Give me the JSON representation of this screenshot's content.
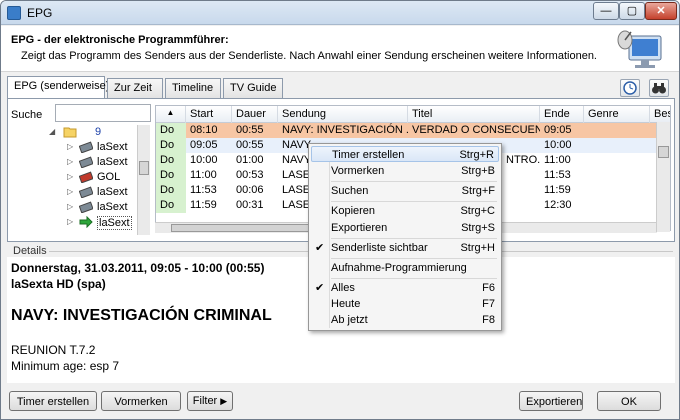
{
  "window": {
    "title": "EPG",
    "close_glyph": "✕",
    "minimize_glyph": "—",
    "maximize_glyph": "▢"
  },
  "header": {
    "title": "EPG - der elektronische Programmführer:",
    "description": "Zeigt das Programm des Senders aus der Senderliste. Nach Anwahl einer Sendung erscheinen weitere Informationen.",
    "icon": "monitor-satellite-icon"
  },
  "tabs": [
    "EPG (senderweise)",
    "Zur Zeit",
    "Timeline",
    "TV Guide"
  ],
  "toolbar": {
    "clock_icon": "clock-icon",
    "search_icon": "binoculars-icon"
  },
  "search": {
    "label": "Suche",
    "value": ""
  },
  "tree": [
    {
      "label": "9",
      "icon": "folder-icon",
      "expanded": true
    },
    {
      "label": "laSext",
      "icon": "channel-icon"
    },
    {
      "label": "laSext",
      "icon": "channel-icon"
    },
    {
      "label": "GOL",
      "icon": "channel-icon"
    },
    {
      "label": "laSext",
      "icon": "channel-icon"
    },
    {
      "label": "laSext",
      "icon": "channel-icon"
    },
    {
      "label": "laSext",
      "icon": "arrow-right-icon",
      "current": true
    }
  ],
  "grid": {
    "columns": [
      "Start",
      "Dauer",
      "Sendung",
      "Titel",
      "Ende",
      "Genre",
      "Bes"
    ],
    "rows": [
      {
        "day": "Do",
        "start": "08:10",
        "dauer": "00:55",
        "sendung": "NAVY: INVESTIGACIÓN ...",
        "titel": "VERDAD O CONSECUEN...",
        "ende": "09:05",
        "selected": true
      },
      {
        "day": "Do",
        "start": "09:05",
        "dauer": "00:55",
        "sendung": "NAVY",
        "titel": "",
        "ende": "10:00"
      },
      {
        "day": "Do",
        "start": "10:00",
        "dauer": "01:00",
        "sendung": "NAVY",
        "titel": "NTRO...",
        "ende": "11:00"
      },
      {
        "day": "Do",
        "start": "11:00",
        "dauer": "00:53",
        "sendung": "LASE",
        "titel": "",
        "ende": "11:53"
      },
      {
        "day": "Do",
        "start": "11:53",
        "dauer": "00:06",
        "sendung": "LASE",
        "titel": "",
        "ende": "11:59"
      },
      {
        "day": "Do",
        "start": "11:59",
        "dauer": "00:31",
        "sendung": "LASE",
        "titel": "",
        "ende": "12:30"
      }
    ]
  },
  "details": {
    "label": "Details",
    "line1": "Donnerstag, 31.03.2011, 09:05 - 10:00  (00:55)",
    "line2": "laSexta HD (spa)",
    "title": "NAVY: INVESTIGACIÓN CRIMINAL",
    "line3": "REUNION T.7.2",
    "line4": "Minimum age: esp 7"
  },
  "buttons": {
    "timer": "Timer erstellen",
    "vormerken": "Vormerken",
    "filter": "Filter",
    "exportieren": "Exportieren",
    "ok": "OK"
  },
  "context_menu": [
    {
      "label": "Timer erstellen",
      "shortcut": "Strg+R",
      "highlighted": true
    },
    {
      "label": "Vormerken",
      "shortcut": "Strg+B"
    },
    {
      "separator": true
    },
    {
      "label": "Suchen",
      "shortcut": "Strg+F"
    },
    {
      "separator": true
    },
    {
      "label": "Kopieren",
      "shortcut": "Strg+C"
    },
    {
      "label": "Exportieren",
      "shortcut": "Strg+S"
    },
    {
      "separator": true
    },
    {
      "label": "Senderliste sichtbar",
      "shortcut": "Strg+H",
      "checked": true
    },
    {
      "separator": true
    },
    {
      "label": "Aufnahme-Programmierung",
      "shortcut": ""
    },
    {
      "separator": true
    },
    {
      "label": "Alles",
      "shortcut": "F6",
      "checked": true
    },
    {
      "label": "Heute",
      "shortcut": "F7"
    },
    {
      "label": "Ab jetzt",
      "shortcut": "F8"
    }
  ]
}
